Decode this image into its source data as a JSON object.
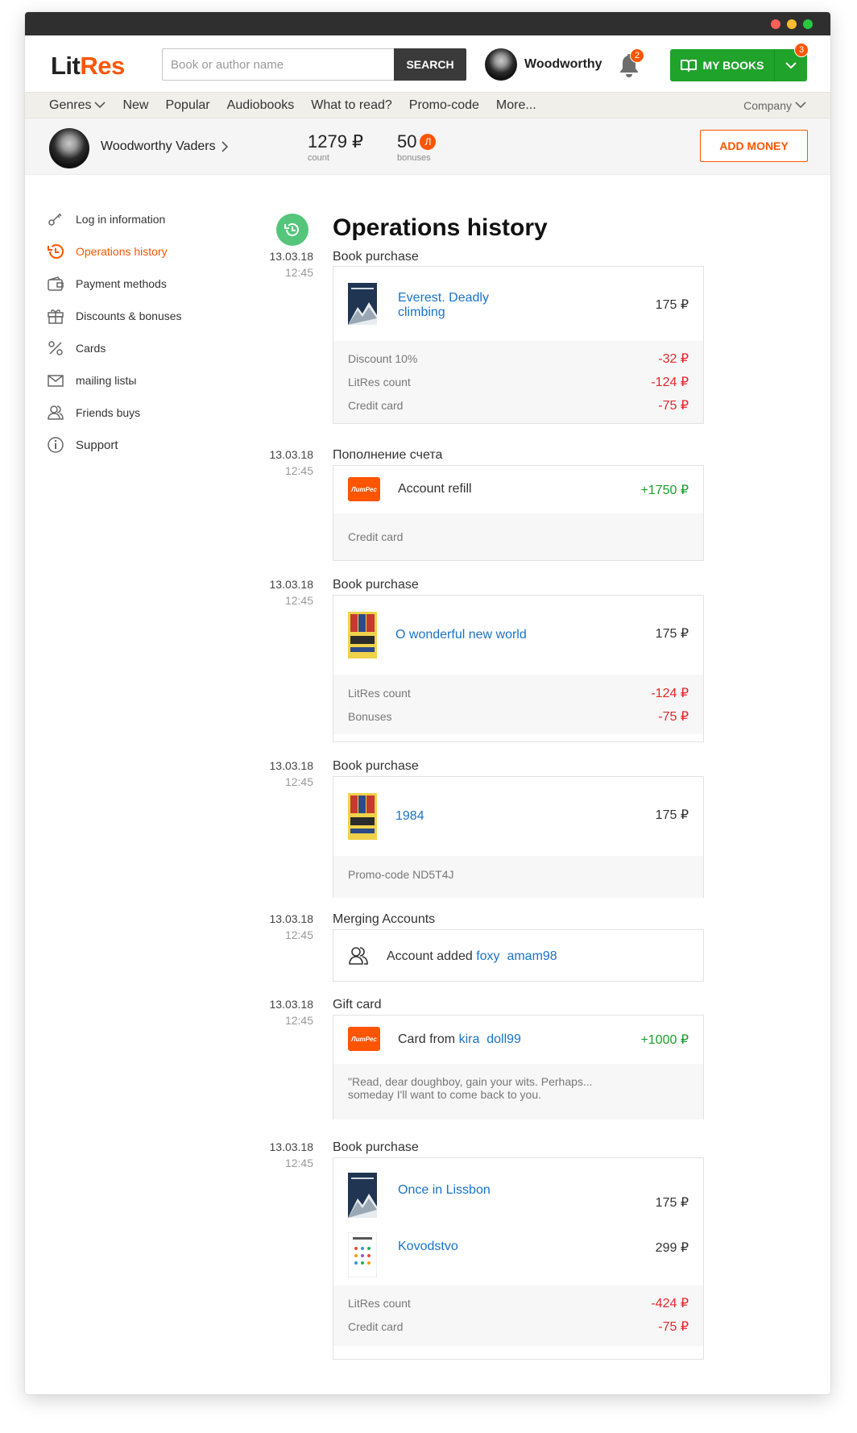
{
  "window": {
    "brand": {
      "lit": "Lit",
      "res": "Res"
    }
  },
  "search": {
    "placeholder": "Book or author name",
    "button": "SEARCH"
  },
  "header": {
    "user_name": "Woodworthy",
    "bell_count": "2",
    "my_books_label": "MY BOOKS",
    "my_books_count": "3"
  },
  "nav": {
    "items": [
      "Genres",
      "New",
      "Popular",
      "Audiobooks",
      "What to read?",
      "Promo-code",
      "More..."
    ],
    "company": "Company"
  },
  "userbar": {
    "name": "Woodworthy Vaders",
    "count_value": "1279 ₽",
    "count_label": "count",
    "bonus_value": "50",
    "bonus_coin": "Л",
    "bonus_label": "bonuses",
    "add_money": "ADD MONEY"
  },
  "sidebar": {
    "items": [
      "Log in information",
      "Operations history",
      "Payment methods",
      "Discounts & bonuses",
      "Cards",
      "mailing listы",
      "Friends buys",
      "Support"
    ]
  },
  "page": {
    "title": "Operations history"
  },
  "colors": {
    "accent": "#ff5500",
    "green": "#1fa32b",
    "link": "#1a73c8",
    "negative": "#e5262a",
    "positive": "#1a9e2a"
  },
  "ops": [
    {
      "date": "13.03.18",
      "time": "12:45",
      "title": "Book purchase",
      "book": {
        "title": "Everest. Deadly climbing",
        "price": "175 ₽"
      },
      "payments": [
        {
          "label": "Discount 10%",
          "amount": "-32 ₽"
        },
        {
          "label": "LitRes count",
          "amount": "-124 ₽"
        },
        {
          "label": "Credit card",
          "amount": "-75 ₽"
        }
      ]
    },
    {
      "date": "13.03.18",
      "time": "12:45",
      "title": "Пополнение счета",
      "logo_text": "ЛитРес",
      "item": "Account refill",
      "amount": "+1750 ₽",
      "method": "Credit card"
    },
    {
      "date": "13.03.18",
      "time": "12:45",
      "title": "Book purchase",
      "book": {
        "title": "O wonderful new world",
        "price": "175 ₽"
      },
      "payments": [
        {
          "label": "LitRes count",
          "amount": "-124 ₽"
        },
        {
          "label": "Bonuses",
          "amount": "-75 ₽"
        }
      ]
    },
    {
      "date": "13.03.18",
      "time": "12:45",
      "title": "Book purchase",
      "book": {
        "title": "1984",
        "price": "175 ₽"
      },
      "promo": "Promo-code ND5T4J"
    },
    {
      "date": "13.03.18",
      "time": "12:45",
      "title": "Merging Accounts",
      "text": "Account added",
      "user1": "foxy",
      "user2": "amam98"
    },
    {
      "date": "13.03.18",
      "time": "12:45",
      "title": "Gift card",
      "logo_text": "ЛитРес",
      "text": "Card from",
      "user1": "kira",
      "user2": "doll99",
      "amount": "+1000 ₽",
      "quote_line1": "\"Read, dear doughboy, gain your wits. Perhaps...",
      "quote_line2": "someday I'll want to come back to you."
    },
    {
      "date": "13.03.18",
      "time": "12:45",
      "title": "Book purchase",
      "books": [
        {
          "title": "Once in Lissbon",
          "price": "175 ₽"
        },
        {
          "title": "Kovodstvo",
          "price": "299 ₽"
        }
      ],
      "payments": [
        {
          "label": "LitRes count",
          "amount": "-424 ₽"
        },
        {
          "label": "Credit card",
          "amount": "-75 ₽"
        }
      ]
    }
  ]
}
